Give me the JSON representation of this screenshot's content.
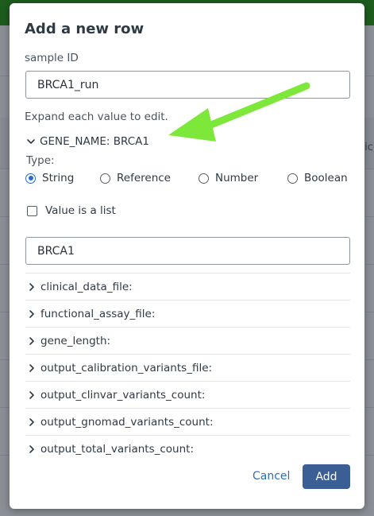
{
  "background": {
    "peek_text": "tic"
  },
  "modal": {
    "title": "Add a new row",
    "sample_label": "sample ID",
    "sample_value": "BRCA1_run",
    "hint": "Expand each value to edit.",
    "gene_section": {
      "label": "GENE_NAME: BRCA1",
      "expanded": true,
      "type_label": "Type:",
      "types": [
        {
          "label": "String",
          "checked": true
        },
        {
          "label": "Reference",
          "checked": false
        },
        {
          "label": "Number",
          "checked": false
        },
        {
          "label": "Boolean",
          "checked": false
        }
      ],
      "list_checkbox_label": "Value is a list",
      "list_checked": false,
      "value": "BRCA1"
    },
    "fields": [
      {
        "label": "clinical_data_file:"
      },
      {
        "label": "functional_assay_file:"
      },
      {
        "label": "gene_length:"
      },
      {
        "label": "output_calibration_variants_file:"
      },
      {
        "label": "output_clinvar_variants_count:"
      },
      {
        "label": "output_gnomad_variants_count:"
      },
      {
        "label": "output_total_variants_count:"
      }
    ],
    "cancel_label": "Cancel",
    "add_label": "Add"
  },
  "colors": {
    "accent": "#2a6cc7",
    "primary_button": "#3b5f95",
    "link": "#2d6fb5",
    "annotation_arrow": "#7ee83a",
    "topbar": "#1e5c1e"
  }
}
